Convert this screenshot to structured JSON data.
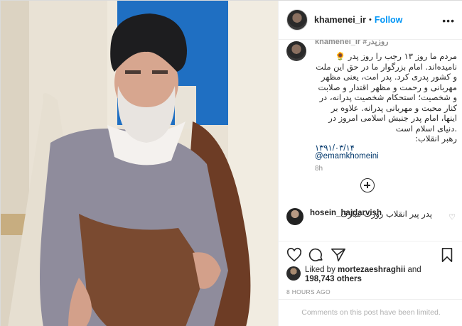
{
  "header": {
    "username": "khamenei_ir",
    "separator": "•",
    "follow_label": "Follow",
    "more_icon": "more-horizontal-icon"
  },
  "caption": {
    "username": "khamenei_ir #روزپدر",
    "lines": [
      "مردم ما روز ۱۳ رجب را روز پدر 🌻",
      "نامیده‌اند. امام بزرگوار ما در حق این ملت",
      "و کشور پدری کرد. پدر امت، یعنی مظهر",
      "مهربانی و رحمت و مظهر اقتدار و صلابت",
      "و شخصیت؛ استحکام شخصیت پدرانه، در",
      "کنار محبت و مهربانی پدرانه. علاوه بر",
      "اینها، امام پدر جنبش اسلامی امروز در",
      ".دنیای اسلام است",
      "رهبر انقلاب:",
      "۱۳۹۱/۰۳/۱۴"
    ],
    "mention": "@emamkhomeini",
    "time": "8h"
  },
  "comment": {
    "username": "hosein_hajdarvish",
    "text": "پدر پیر انقلاب روزت مبارک"
  },
  "likes": {
    "prefix": "Liked by",
    "liker": "mortezaeshraghii",
    "connector": "and",
    "count": "198,743 others"
  },
  "post_time": "8 HOURS AGO",
  "comments_limited": "Comments on this post have been limited."
}
